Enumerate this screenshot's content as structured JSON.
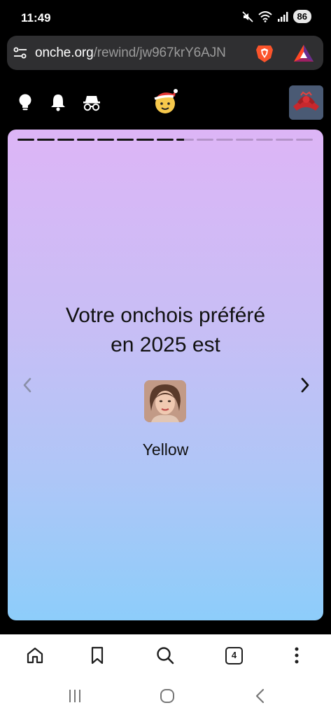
{
  "status_bar": {
    "time": "11:49",
    "battery": "86"
  },
  "url_bar": {
    "domain": "onche.org",
    "path": "/rewind/jw967krY6AJN"
  },
  "story": {
    "title_line1": "Votre onchois préféré",
    "title_line2": "en 2025 est",
    "winner_name": "Yellow",
    "progress": {
      "total_segments": 15,
      "completed_segments": 8,
      "current_segment_fraction": 0.45
    }
  },
  "bottom_bar": {
    "tab_count": "4"
  },
  "colors": {
    "gradient_top": "#ddb5f6",
    "gradient_bottom": "#8dcdfa",
    "brave_orange": "#fb542b",
    "url_bar_bg": "#2f2f31"
  },
  "icons": {
    "site_nav": [
      "lightbulb-icon",
      "bell-icon",
      "incognito-icon"
    ],
    "bottom_bar": [
      "home-icon",
      "bookmark-icon",
      "search-icon",
      "tabs-icon",
      "more-icon"
    ],
    "system_nav": [
      "recents-icon",
      "home-circle-icon",
      "back-icon"
    ]
  }
}
